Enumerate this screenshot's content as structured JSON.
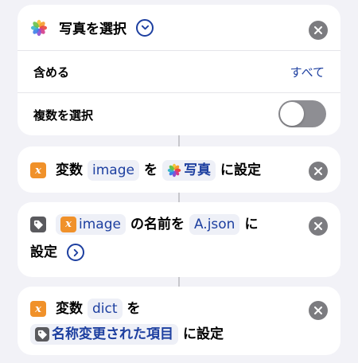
{
  "colors": {
    "background": "#f2f2f7",
    "card": "#ffffff",
    "token_text": "#1d3fa0",
    "token_bg": "#eef0f7",
    "variable_orange": "#f0912a",
    "toggle_off": "#8e8e93"
  },
  "select_photos": {
    "icon": "photos-icon",
    "title": "写真を選択",
    "include_label": "含める",
    "include_value": "すべて",
    "select_multiple_label": "複数を選択",
    "select_multiple_on": false
  },
  "set_variable_1": {
    "icon": "variable-icon",
    "prefix": "変数",
    "variable_name": "image",
    "connector": "を",
    "value_icon": "photos-icon",
    "value": "写真",
    "suffix": "に設定"
  },
  "rename_item": {
    "icon": "tag-icon",
    "input_icon": "variable-icon",
    "input": "image",
    "middle": "の名前を",
    "new_name": "A.json",
    "suffix_1": "に",
    "suffix_2": "設定"
  },
  "set_variable_2": {
    "icon": "variable-icon",
    "prefix": "変数",
    "variable_name": "dict",
    "connector": "を",
    "value_icon": "tag-icon",
    "value": "名称変更された項目",
    "suffix": "に設定"
  },
  "variable_glyph": "x"
}
